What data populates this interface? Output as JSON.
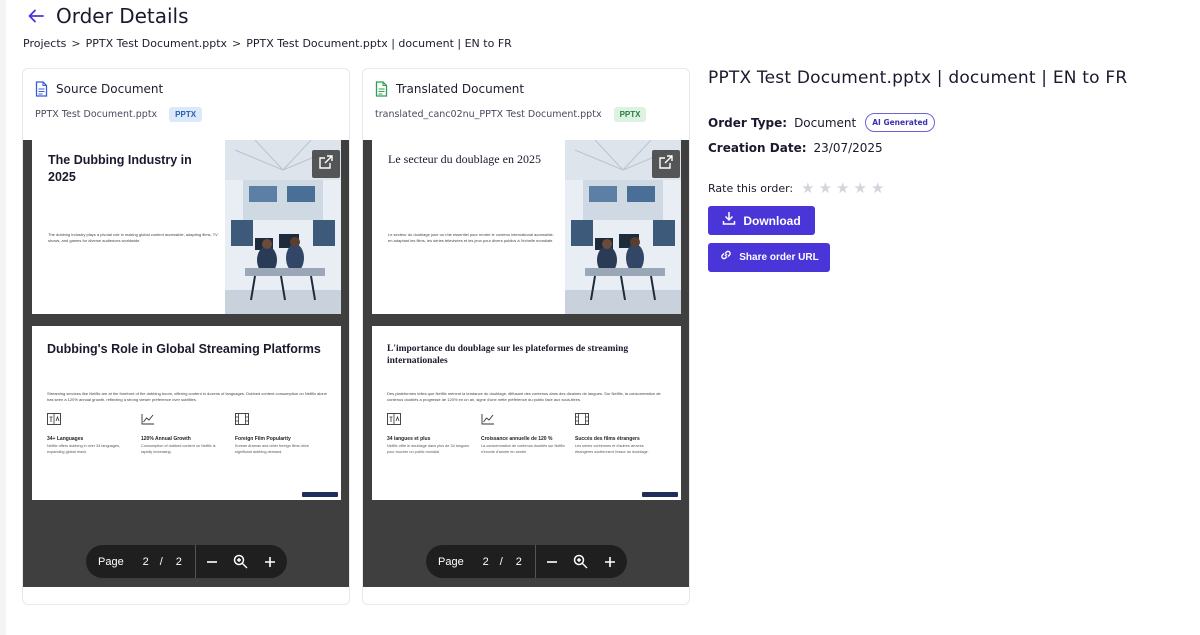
{
  "header": {
    "title": "Order Details"
  },
  "breadcrumb": {
    "items": [
      "Projects",
      "PPTX Test Document.pptx",
      "PPTX Test Document.pptx | document | EN to FR"
    ],
    "separator": ">"
  },
  "source": {
    "title": "Source Document",
    "file_name": "PPTX Test Document.pptx",
    "badge": "PPTX",
    "slide1": {
      "title": "The Dubbing Industry in 2025",
      "body": "The dubbing industry plays a pivotal role in making global content accessible, adapting films, TV shows, and games for diverse audiences worldwide."
    },
    "slide2": {
      "title": "Dubbing's Role in Global Streaming Platforms",
      "body": "Streaming services like Netflix are at the forefront of the dubbing boom, offering content in dozens of languages. Dubbed content consumption on Netflix alone has seen a 120% annual growth, reflecting a strong viewer preference over subtitles.",
      "features": [
        {
          "title": "34+ Languages",
          "desc": "Netflix offers dubbing in over 34 languages, expanding global reach."
        },
        {
          "title": "120% Annual Growth",
          "desc": "Consumption of dubbed content on Netflix is rapidly increasing."
        },
        {
          "title": "Foreign Film Popularity",
          "desc": "Korean dramas and other foreign films drive significant dubbing demand."
        }
      ]
    },
    "pager": {
      "label": "Page",
      "current": "2",
      "separator": "/",
      "total": "2"
    }
  },
  "translated": {
    "title": "Translated Document",
    "file_name": "translated_canc02nu_PPTX Test Document.pptx",
    "badge": "PPTX",
    "slide1": {
      "title": "Le secteur du doublage en 2025",
      "body": "Le secteur du doublage joue un rôle essentiel pour rendre le contenu international accessible, en adaptant les films, les séries télévisées et les jeux pour divers publics à l'échelle mondiale."
    },
    "slide2": {
      "title": "L'importance du doublage sur les plateformes de streaming internationales",
      "body": "Des plateformes telles que Netflix mènent la tendance du doublage, diffusant des contenus dans des dizaines de langues. Sur Netflix, la consommation de contenus doublés a progressé de 120% en un an, signe d'une nette préférence du public face aux sous-titres.",
      "features": [
        {
          "title": "34 langues et plus",
          "desc": "Netflix offre le doublage dans plus de 34 langues pour toucher un public mondial."
        },
        {
          "title": "Croissance annuelle de 120 %",
          "desc": "La consommation de contenus doublés sur Netflix s'envole d'année en année."
        },
        {
          "title": "Succès des films étrangers",
          "desc": "Les séries coréennes et d'autres œuvres étrangères soutiennent l'essor du doublage."
        }
      ]
    },
    "pager": {
      "label": "Page",
      "current": "2",
      "separator": "/",
      "total": "2"
    }
  },
  "order": {
    "title": "PPTX Test Document.pptx | document | EN to FR",
    "type_label": "Order Type:",
    "type_value": "Document",
    "ai_badge": "AI Generated",
    "date_label": "Creation Date:",
    "date_value": "23/07/2025",
    "rate_label": "Rate this order:",
    "stars": 5,
    "download_label": "Download",
    "share_label": "Share order URL"
  },
  "colors": {
    "accent": "#4935d8",
    "viewer_bg": "#3f3f3f",
    "pager_bg": "#1f1f1f"
  }
}
